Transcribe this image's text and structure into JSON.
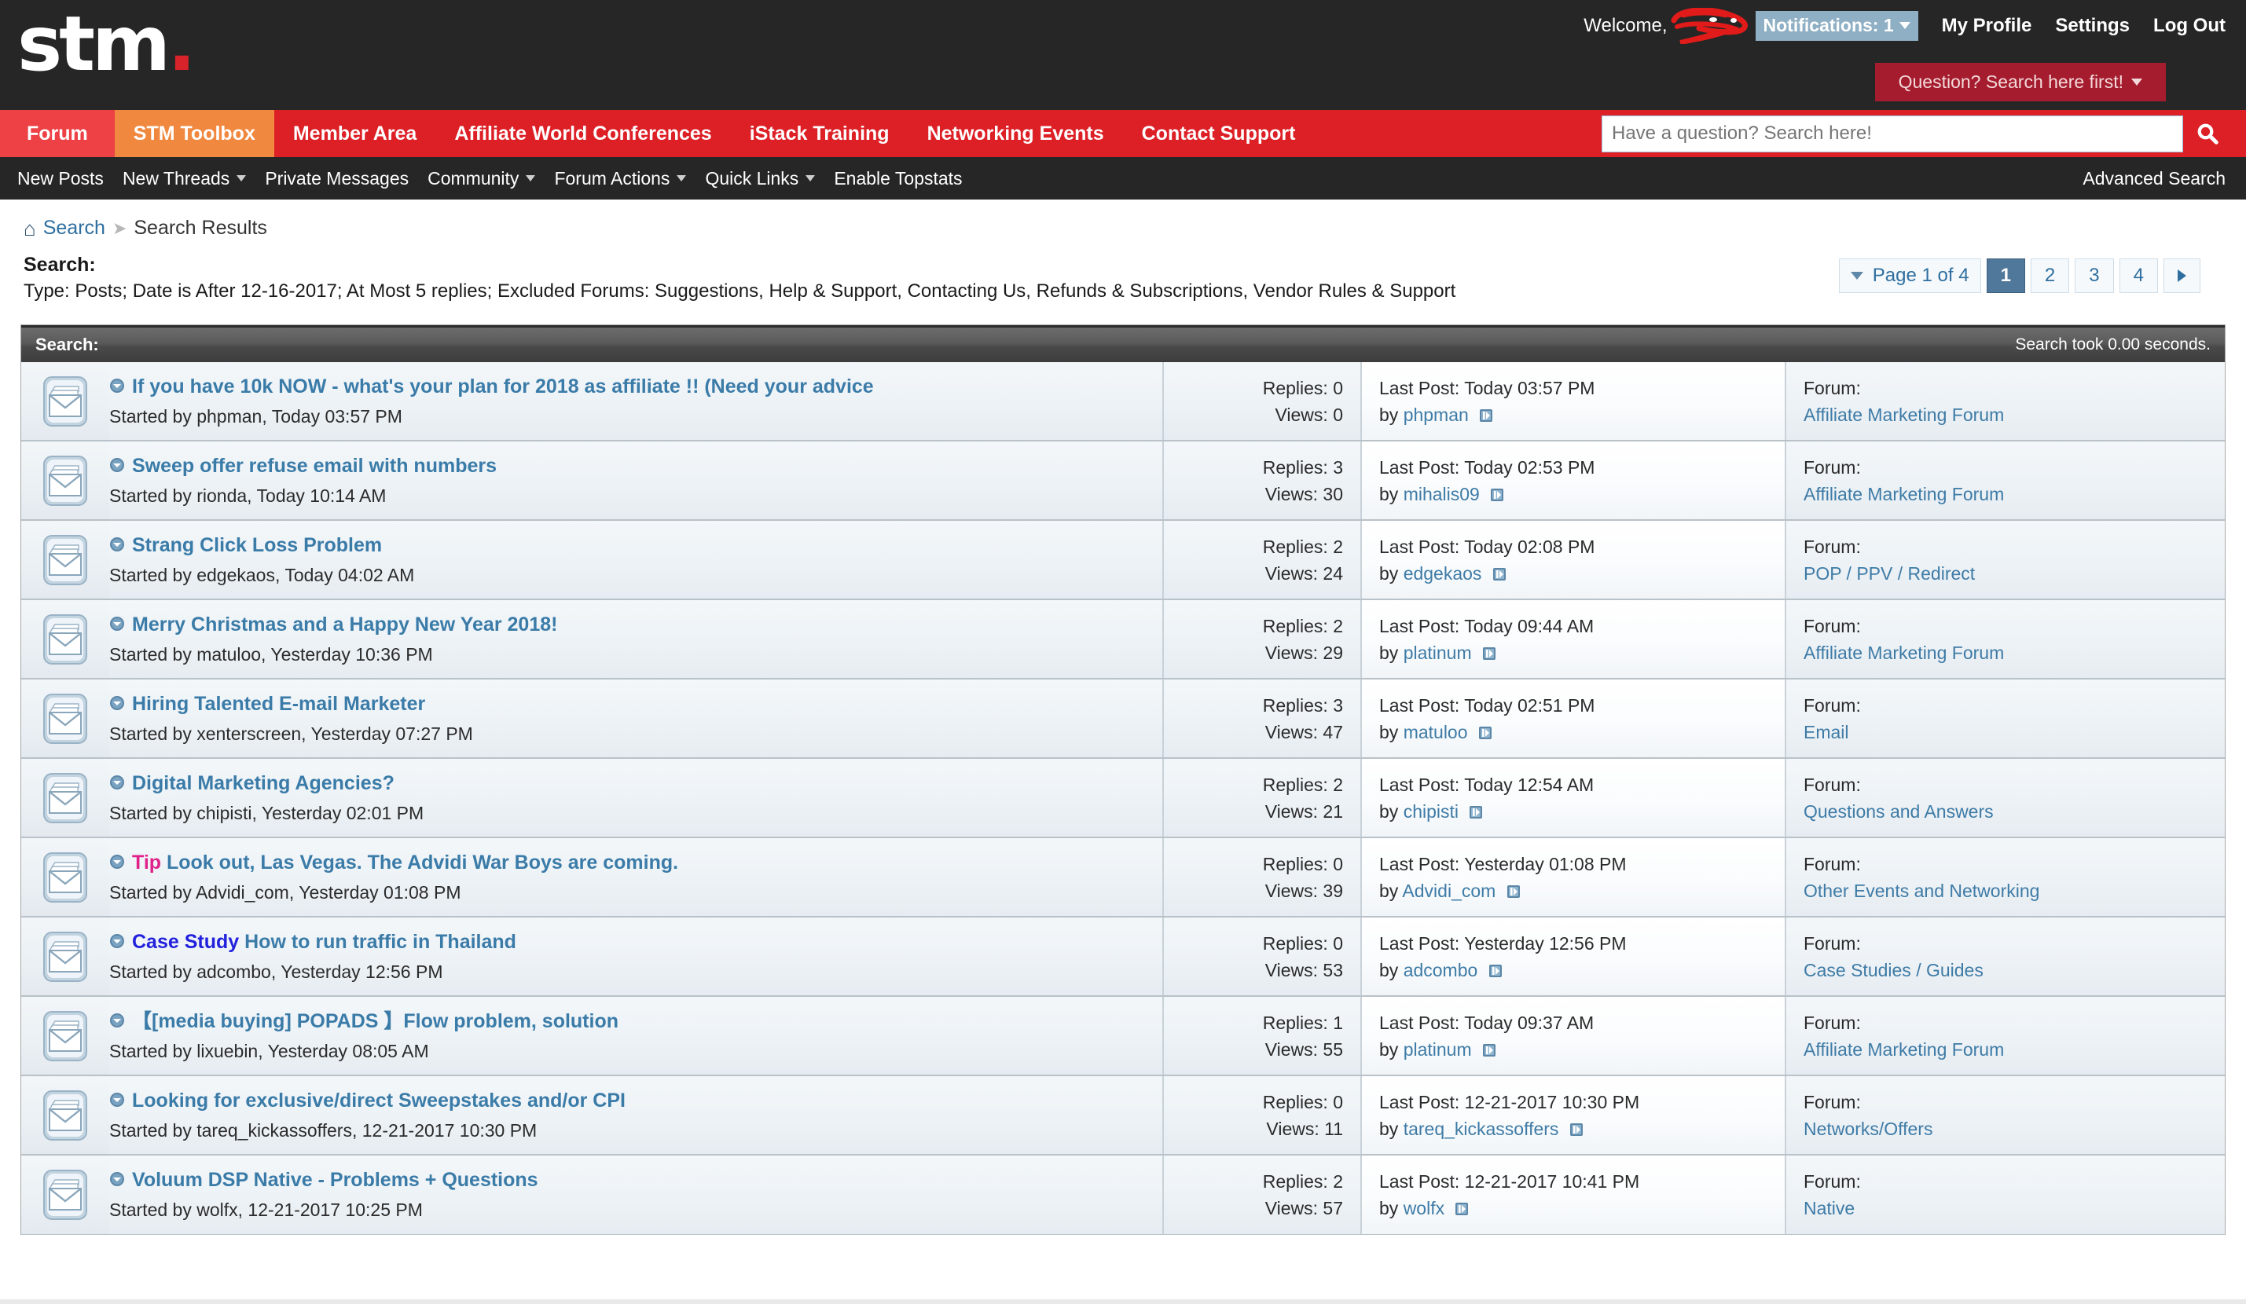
{
  "site": {
    "logo_text": "stm",
    "logo_dot": "."
  },
  "header": {
    "welcome_label": "Welcome,",
    "username_redacted": "redacted-username-scribble",
    "notifications_label": "Notifications: 1",
    "links": [
      {
        "label": "My Profile"
      },
      {
        "label": "Settings"
      },
      {
        "label": "Log Out"
      }
    ],
    "question_button": "Question? Search here first!"
  },
  "mainnav": [
    {
      "label": "Forum",
      "state": "active"
    },
    {
      "label": "STM Toolbox",
      "state": "toolbox"
    },
    {
      "label": "Member Area",
      "state": "normal"
    },
    {
      "label": "Affiliate World Conferences",
      "state": "normal"
    },
    {
      "label": "iStack Training",
      "state": "normal"
    },
    {
      "label": "Networking Events",
      "state": "normal"
    },
    {
      "label": "Contact Support",
      "state": "normal"
    }
  ],
  "search": {
    "placeholder": "Have a question? Search here!",
    "value": "",
    "button_icon": "search-icon"
  },
  "subnav": {
    "items": [
      {
        "label": "New Posts",
        "caret": false
      },
      {
        "label": "New Threads",
        "caret": true
      },
      {
        "label": "Private Messages",
        "caret": false
      },
      {
        "label": "Community",
        "caret": true
      },
      {
        "label": "Forum Actions",
        "caret": true
      },
      {
        "label": "Quick Links",
        "caret": true
      },
      {
        "label": "Enable Topstats",
        "caret": false
      }
    ],
    "advanced_search": "Advanced Search"
  },
  "breadcrumb": {
    "home_icon": "home-icon",
    "search_link": "Search",
    "current": "Search Results"
  },
  "criteria": {
    "label": "Search:",
    "description": "Type: Posts; Date is After 12-16-2017; At Most 5 replies; Excluded Forums: Suggestions, Help & Support, Contacting Us, Refunds & Subscriptions, Vendor Rules & Support"
  },
  "pagination": {
    "page_label": "Page 1 of 4",
    "pages": [
      "1",
      "2",
      "3",
      "4"
    ],
    "current_page": "1",
    "next_icon": "chevron-right-icon",
    "menu_icon": "chevron-down-icon"
  },
  "results_panel": {
    "title": "Search:",
    "took": "Search took 0.00 seconds."
  },
  "labels": {
    "started_by": "Started by",
    "replies": "Replies:",
    "views": "Views:",
    "last_post": "Last Post:",
    "by": "by",
    "forum": "Forum:"
  },
  "results": [
    {
      "prefix": "",
      "prefix_type": "",
      "title": "If you have 10k NOW - what's your plan for 2018 as affiliate !! (Need your advice",
      "started_by": "phpman",
      "started_at": "Today 03:57 PM",
      "replies": "0",
      "views": "0",
      "last_post": "Today 03:57 PM",
      "last_post_by": "phpman",
      "forum": "Affiliate Marketing Forum"
    },
    {
      "prefix": "",
      "prefix_type": "",
      "title": "Sweep offer refuse email with numbers",
      "started_by": "rionda",
      "started_at": "Today 10:14 AM",
      "replies": "3",
      "views": "30",
      "last_post": "Today 02:53 PM",
      "last_post_by": "mihalis09",
      "forum": "Affiliate Marketing Forum"
    },
    {
      "prefix": "",
      "prefix_type": "",
      "title": "Strang Click Loss Problem",
      "started_by": "edgekaos",
      "started_at": "Today 04:02 AM",
      "replies": "2",
      "views": "24",
      "last_post": "Today 02:08 PM",
      "last_post_by": "edgekaos",
      "forum": "POP / PPV / Redirect"
    },
    {
      "prefix": "",
      "prefix_type": "",
      "title": "Merry Christmas and a Happy New Year 2018!",
      "started_by": "matuloo",
      "started_at": "Yesterday 10:36 PM",
      "replies": "2",
      "views": "29",
      "last_post": "Today 09:44 AM",
      "last_post_by": "platinum",
      "forum": "Affiliate Marketing Forum"
    },
    {
      "prefix": "",
      "prefix_type": "",
      "title": "Hiring Talented E-mail Marketer",
      "started_by": "xenterscreen",
      "started_at": "Yesterday 07:27 PM",
      "replies": "3",
      "views": "47",
      "last_post": "Today 02:51 PM",
      "last_post_by": "matuloo",
      "forum": "Email"
    },
    {
      "prefix": "",
      "prefix_type": "",
      "title": "Digital Marketing Agencies?",
      "started_by": "chipisti",
      "started_at": "Yesterday 02:01 PM",
      "replies": "2",
      "views": "21",
      "last_post": "Today 12:54 AM",
      "last_post_by": "chipisti",
      "forum": "Questions and Answers"
    },
    {
      "prefix": "Tip",
      "prefix_type": "tip",
      "title": "Look out, Las Vegas. The Advidi War Boys are coming.",
      "started_by": "Advidi_com",
      "started_at": "Yesterday 01:08 PM",
      "replies": "0",
      "views": "39",
      "last_post": "Yesterday 01:08 PM",
      "last_post_by": "Advidi_com",
      "forum": "Other Events and Networking"
    },
    {
      "prefix": "Case Study",
      "prefix_type": "case",
      "title": "How to run traffic in Thailand",
      "started_by": "adcombo",
      "started_at": "Yesterday 12:56 PM",
      "replies": "0",
      "views": "53",
      "last_post": "Yesterday 12:56 PM",
      "last_post_by": "adcombo",
      "forum": "Case Studies / Guides"
    },
    {
      "prefix": "",
      "prefix_type": "",
      "title": "【[media buying] POPADS 】Flow problem, solution",
      "started_by": "lixuebin",
      "started_at": "Yesterday 08:05 AM",
      "replies": "1",
      "views": "55",
      "last_post": "Today 09:37 AM",
      "last_post_by": "platinum",
      "forum": "Affiliate Marketing Forum"
    },
    {
      "prefix": "",
      "prefix_type": "",
      "title": "Looking for exclusive/direct Sweepstakes and/or CPI",
      "started_by": "tareq_kickassoffers",
      "started_at": "12-21-2017 10:30 PM",
      "replies": "0",
      "views": "11",
      "last_post": "12-21-2017 10:30 PM",
      "last_post_by": "tareq_kickassoffers",
      "forum": "Networks/Offers"
    },
    {
      "prefix": "",
      "prefix_type": "",
      "title": "Voluum DSP Native - Problems + Questions",
      "started_by": "wolfx",
      "started_at": "12-21-2017 10:25 PM",
      "replies": "2",
      "views": "57",
      "last_post": "12-21-2017 10:41 PM",
      "last_post_by": "wolfx",
      "forum": "Native"
    }
  ],
  "colors": {
    "brand_red": "#dd1f26",
    "toolbox_orange": "#f0883f",
    "dark": "#262626",
    "link_blue": "#3a7ba8",
    "tip_pink": "#e0218a",
    "case_blue": "#2222dd",
    "notif_blue": "#8fafc4"
  }
}
